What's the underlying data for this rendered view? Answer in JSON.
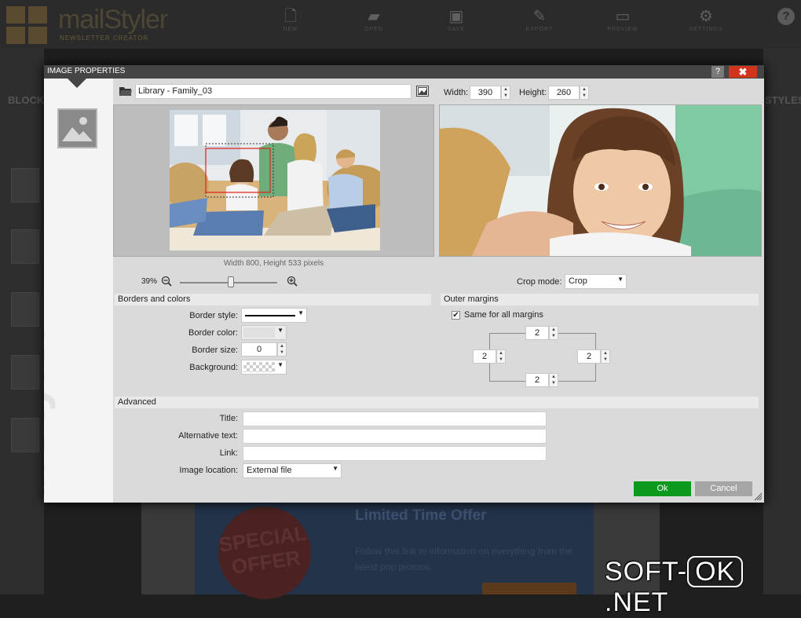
{
  "app": {
    "logo_text": "mailStyler",
    "logo_sub": "NEWSLETTER CREATOR",
    "toolbar": [
      {
        "label": "NEW",
        "icon": "new-file-icon"
      },
      {
        "label": "OPEN",
        "icon": "open-folder-icon"
      },
      {
        "label": "SAVE",
        "icon": "save-icon"
      },
      {
        "label": "EXPORT",
        "icon": "export-icon"
      },
      {
        "label": "PREVIEW",
        "icon": "preview-icon"
      },
      {
        "label": "SETTINGS",
        "icon": "gear-icon"
      }
    ],
    "help_label": "?",
    "left_panel_title": "BLOCK",
    "right_panel_title": "STYLES",
    "promo": {
      "badge_text": "SPECIAL OFFER",
      "title": "Limited Time Offer",
      "text": "Follow this link to information on everything from the latest pop promos."
    }
  },
  "watermark": {
    "left": "SOFT-",
    "box": "OK",
    "right": ".NET"
  },
  "dialog": {
    "title": "IMAGE PROPERTIES",
    "help_label": "?",
    "close_label": "✖",
    "side_watermark": "mailStyler",
    "path_value": "Library - Family_03",
    "width_label": "Width:",
    "width_value": "390",
    "height_label": "Height:",
    "height_value": "260",
    "image_info": "Width  800, Height  533 pixels",
    "zoom_percent": "39%",
    "zoom_level": 0.39,
    "crop_mode_label": "Crop mode:",
    "crop_mode_value": "Crop",
    "borders": {
      "header": "Borders and colors",
      "style_label": "Border style:",
      "color_label": "Border color:",
      "size_label": "Border size:",
      "size_value": "0",
      "background_label": "Background:"
    },
    "margins": {
      "header": "Outer margins",
      "same_label": "Same for all margins",
      "same_checked": true,
      "top": "2",
      "left": "2",
      "right": "2",
      "bottom": "2"
    },
    "advanced": {
      "header": "Advanced",
      "title_label": "Title:",
      "title_value": "",
      "alt_label": "Alternative text:",
      "alt_value": "",
      "link_label": "Link:",
      "link_value": "",
      "location_label": "Image location:",
      "location_value": "External file"
    },
    "ok_label": "Ok",
    "cancel_label": "Cancel"
  }
}
